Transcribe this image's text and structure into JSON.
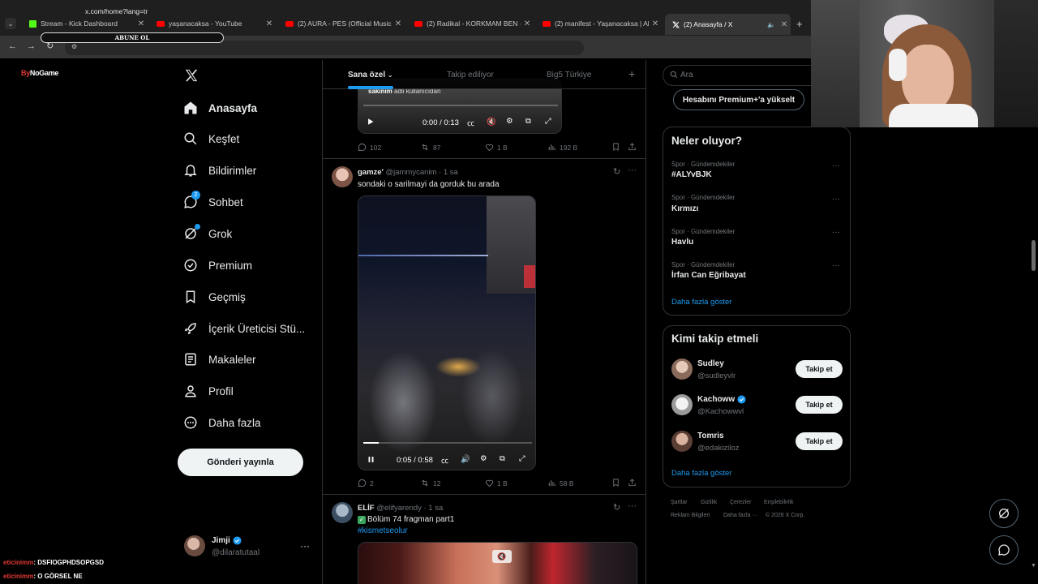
{
  "browser": {
    "tabs": [
      {
        "title": "Stream - Kick Dashboard",
        "icon": "kick-icon",
        "color": "#53fc18"
      },
      {
        "title": "yaşanacaksa - YouTube",
        "icon": "youtube-icon",
        "color": "#ff0000"
      },
      {
        "title": "(2) AURA - PES (Official Music V",
        "icon": "youtube-icon",
        "color": "#ff0000"
      },
      {
        "title": "(2) Radikal - KORKMAM BEN - Y",
        "icon": "youtube-icon",
        "color": "#ff0000"
      },
      {
        "title": "(2) manifest - Yaşanacaksa | Alt",
        "icon": "youtube-icon",
        "color": "#ff0000"
      },
      {
        "title": "(2) Anasayfa / X",
        "icon": "x-icon",
        "color": "#ffffff"
      }
    ],
    "url": "x.com/home?lang=tr"
  },
  "overlay": {
    "subscribe_banner": "ABUNE OL",
    "brand_prefix": "By",
    "brand_name": "NoGame",
    "chat": [
      {
        "user": "eticinimm",
        "message": ": DSFIOGPHDSOPGSD"
      },
      {
        "user": "eticinimm",
        "message": ": O GÖRSEL NE"
      }
    ]
  },
  "nav": {
    "items": [
      {
        "label": "Anasayfa",
        "icon": "home-icon"
      },
      {
        "label": "Keşfet",
        "icon": "search-icon"
      },
      {
        "label": "Bildirimler",
        "icon": "bell-icon"
      },
      {
        "label": "Sohbet",
        "icon": "chat-icon",
        "badge": "2"
      },
      {
        "label": "Grok",
        "icon": "grok-icon"
      },
      {
        "label": "Premium",
        "icon": "premium-icon"
      },
      {
        "label": "Geçmiş",
        "icon": "bookmark-icon"
      },
      {
        "label": "İçerik Üreticisi Stü...",
        "icon": "rocket-icon"
      },
      {
        "label": "Makaleler",
        "icon": "article-icon"
      },
      {
        "label": "Profil",
        "icon": "profile-icon"
      },
      {
        "label": "Daha fazla",
        "icon": "more-circle-icon"
      }
    ],
    "post_button": "Gönderi yayınla",
    "account": {
      "name": "Jimji",
      "handle": "@dilaratutaal",
      "more": "···"
    }
  },
  "timeline": {
    "tabs": [
      "Sana özel",
      "Takip ediliyor",
      "Big5 Türkiye"
    ],
    "add_tab": "+",
    "posts": [
      {
        "caption_overlay": "sakinim",
        "caption_sub": "adli kullanıcıdan",
        "video_time": "0:00 / 0:13",
        "replies": "102",
        "reposts": "87",
        "likes": "1 B",
        "views": "192 B"
      },
      {
        "name": "gamze'",
        "handle": "@jammycanim",
        "time": "· 1 sa",
        "text": "sondaki o sarilmayi da gorduk bu arada",
        "video_time": "0:05 / 0:58",
        "progress": 0.09,
        "replies": "2",
        "reposts": "12",
        "likes": "1 B",
        "views": "58 B"
      },
      {
        "name": "ELİF",
        "handle": "@elifyarendy",
        "time": "· 1 sa",
        "text": "Bölüm 74 fragman part1",
        "hashtag": "#kismetseolur"
      }
    ]
  },
  "sidebar": {
    "search_placeholder": "Ara",
    "premium_button": "Hesabını Premium+'a yükselt",
    "trends_title": "Neler oluyor?",
    "trends": [
      {
        "category": "Spor · Gündemdekiler",
        "name": "#ALYvBJK"
      },
      {
        "category": "Spor · Gündemdekiler",
        "name": "Kırmızı"
      },
      {
        "category": "Spor · Gündemdekiler",
        "name": "Havlu"
      },
      {
        "category": "Spor · Gündemdekiler",
        "name": "İrfan Can Eğribayat"
      }
    ],
    "trends_more": "Daha fazla göster",
    "who_title": "Kimi takip etmeli",
    "who": [
      {
        "name": "Sudley",
        "handle": "@sudleyvlr",
        "verified": false,
        "button": "Takip et"
      },
      {
        "name": "Kachoww",
        "handle": "@Kachowwvl",
        "verified": true,
        "button": "Takip et"
      },
      {
        "name": "Tomris",
        "handle": "@edakiziloz",
        "verified": false,
        "button": "Takip et"
      }
    ],
    "who_more": "Daha fazla göster",
    "footer": [
      "Şartlar",
      "Gizlilik",
      "Çerezler",
      "Erişilebilirlik",
      "Reklam Bilgileri",
      "Daha fazla ···",
      "© 2026 X Corp."
    ]
  },
  "colors": {
    "accent": "#1d9bf0",
    "background": "#000000",
    "border": "#2f3336",
    "muted": "#71767b"
  }
}
